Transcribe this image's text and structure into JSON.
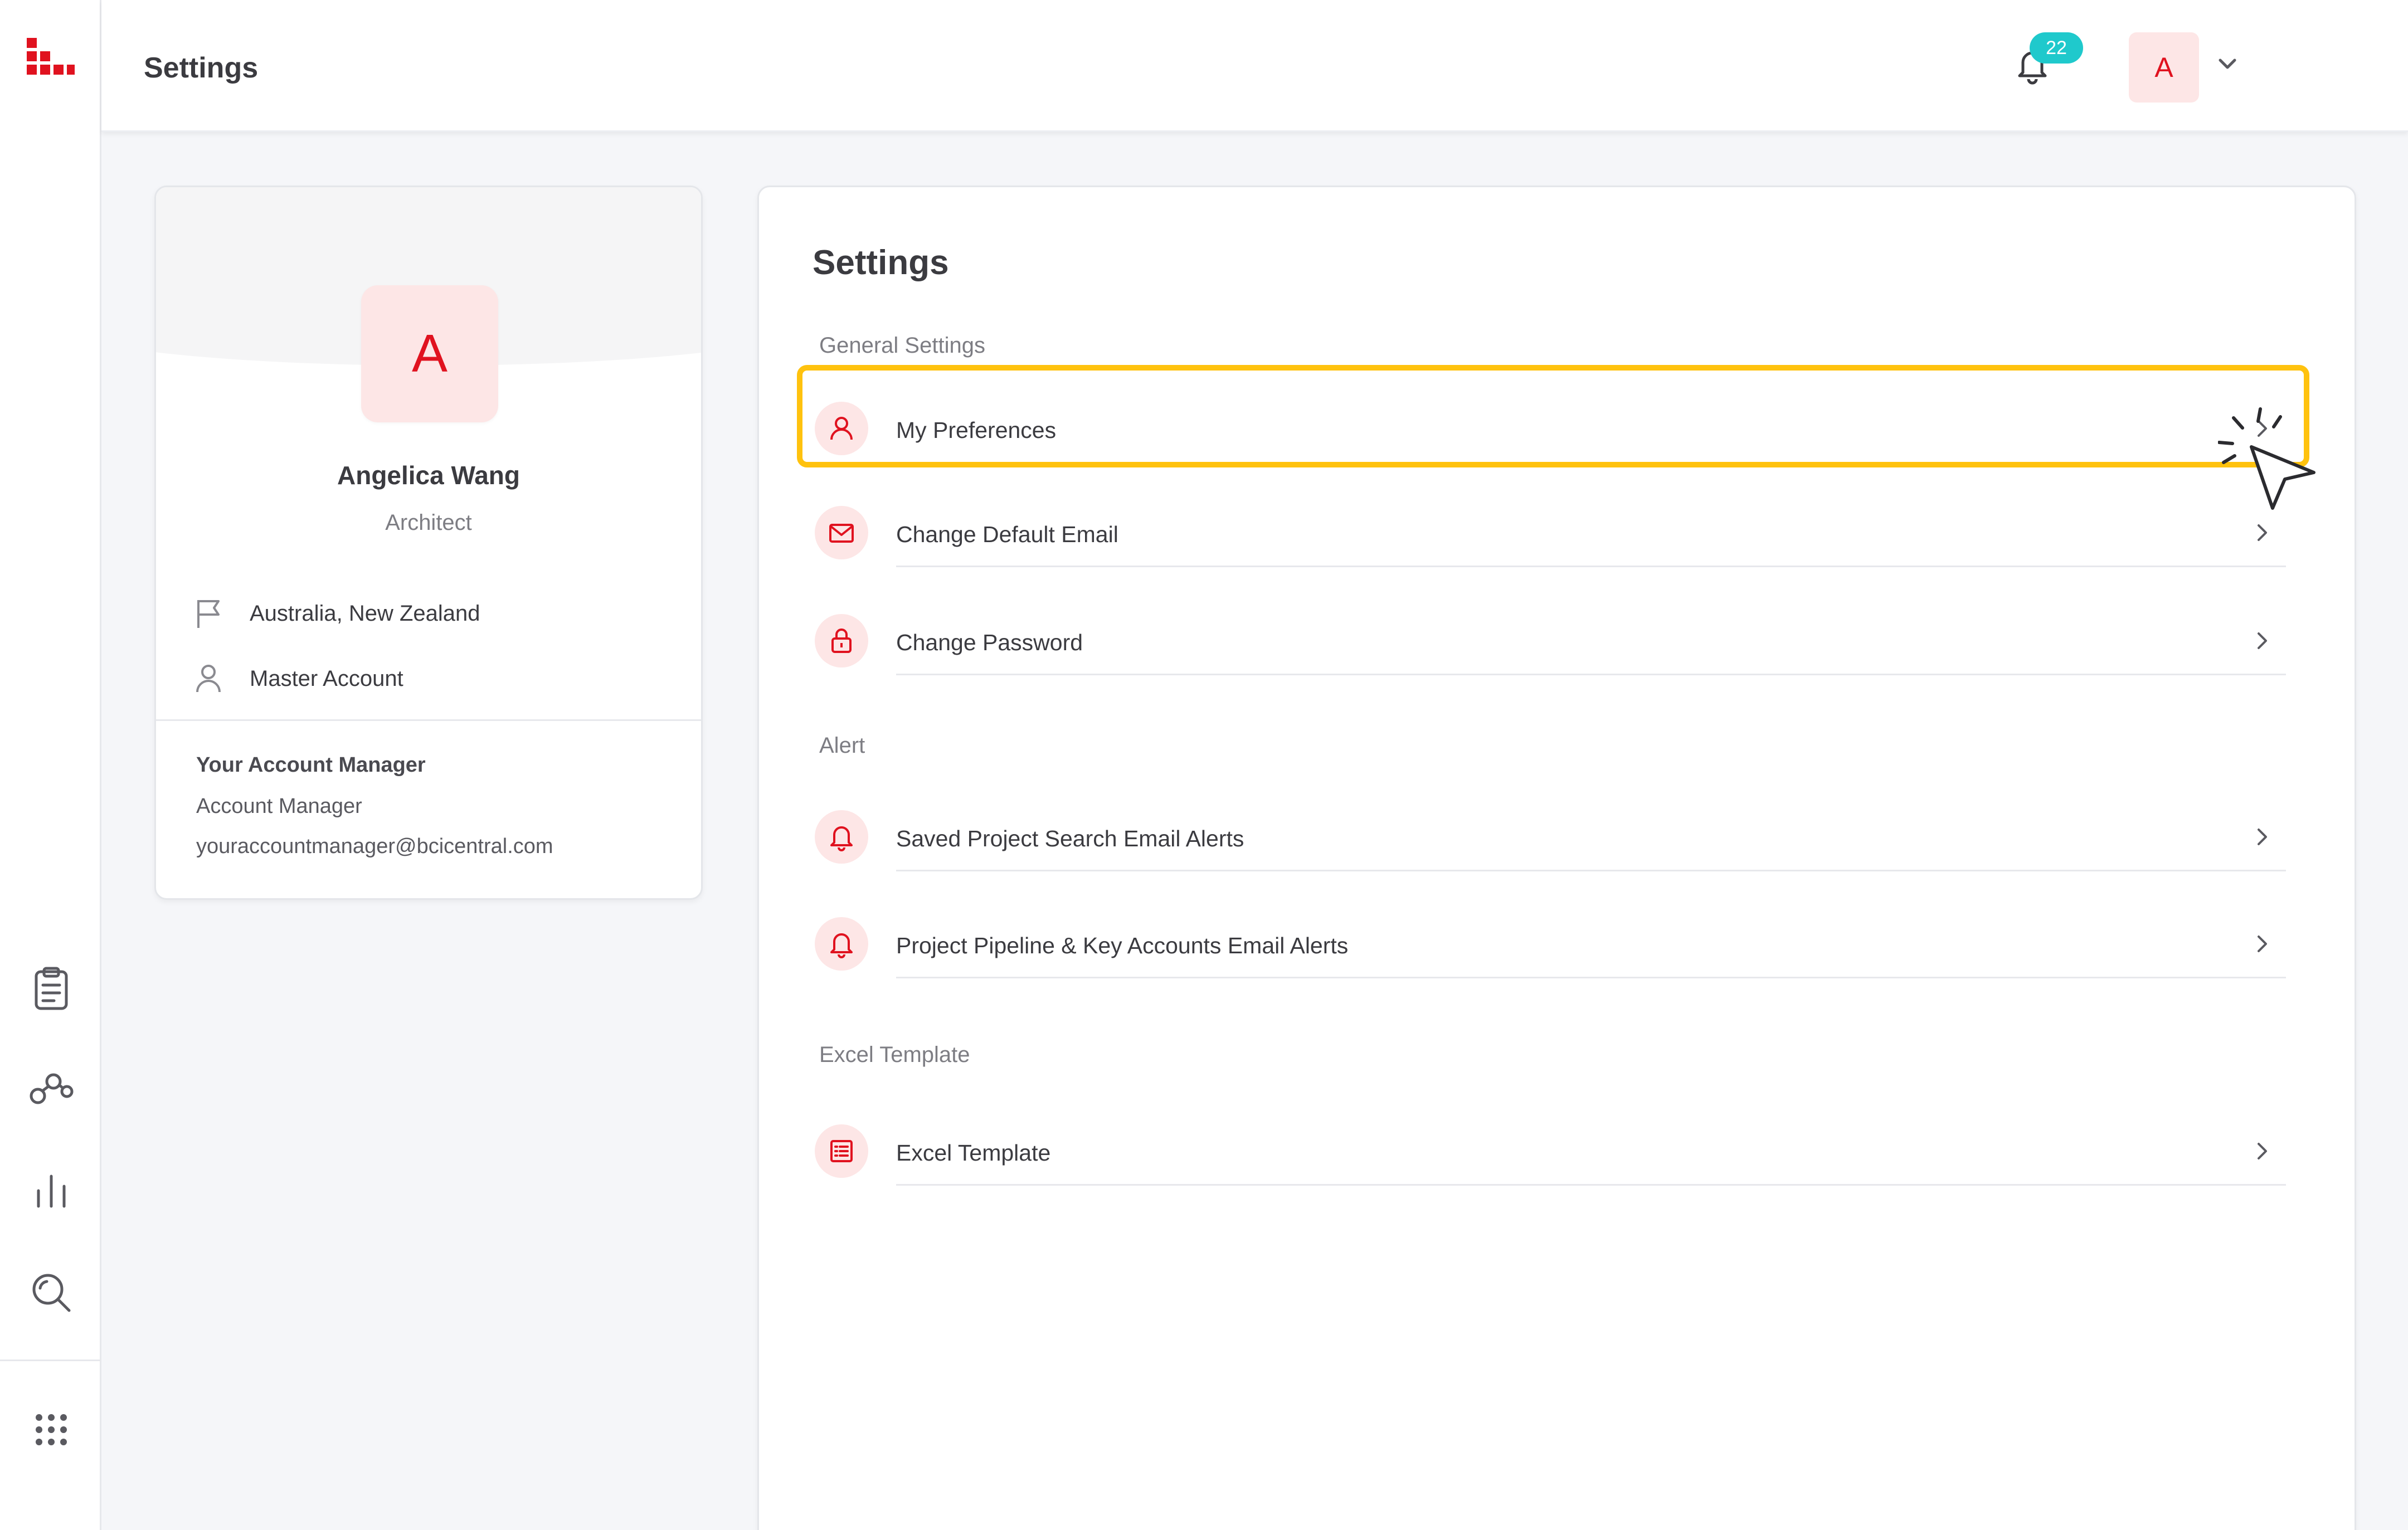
{
  "header": {
    "title": "Settings",
    "notification_count": "22",
    "user_initial": "A"
  },
  "profile": {
    "initial": "A",
    "name": "Angelica Wang",
    "role": "Architect",
    "region": "Australia, New Zealand",
    "account_type": "Master Account",
    "manager_title": "Your Account Manager",
    "manager_name": "Account Manager",
    "manager_email": "youraccountmanager@bcicentral.com"
  },
  "settings": {
    "title": "Settings",
    "sections": [
      {
        "label": "General Settings",
        "items": [
          {
            "label": "My Preferences",
            "icon": "user-icon"
          },
          {
            "label": "Change Default Email",
            "icon": "mail-icon"
          },
          {
            "label": "Change Password",
            "icon": "lock-icon"
          }
        ]
      },
      {
        "label": "Alert",
        "items": [
          {
            "label": "Saved Project Search Email Alerts",
            "icon": "bell-icon"
          },
          {
            "label": "Project Pipeline & Key Accounts Email Alerts",
            "icon": "bell-icon"
          }
        ]
      },
      {
        "label": "Excel Template",
        "items": [
          {
            "label": "Excel Template",
            "icon": "list-icon"
          }
        ]
      }
    ]
  },
  "colors": {
    "accent": "#e0121f",
    "highlight": "#ffc20e",
    "badge": "#1fc9cc"
  }
}
